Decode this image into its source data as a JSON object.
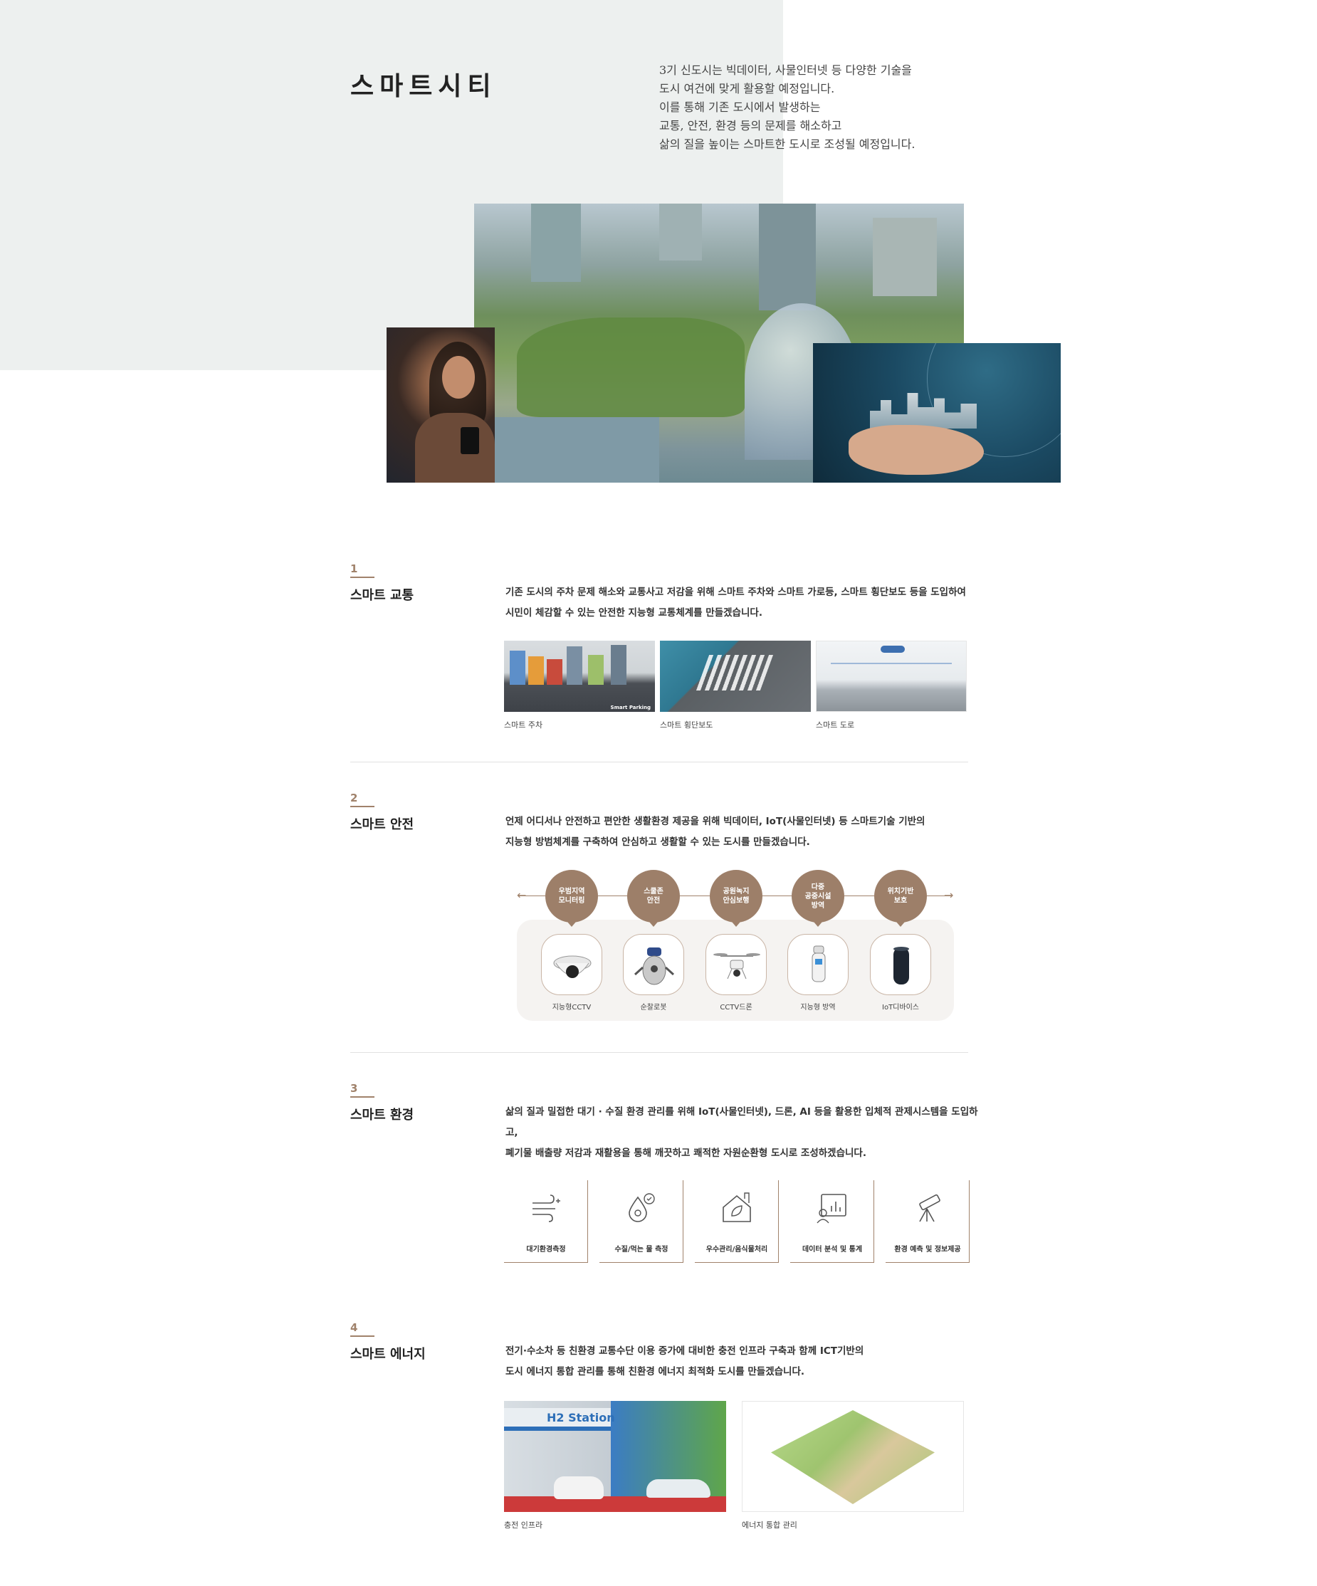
{
  "hero": {
    "title": "스마트시티",
    "desc_lines": [
      "3기 신도시는 빅데이터, 사물인터넷 등 다양한 기술을",
      "도시 여건에 맞게 활용할 예정입니다.",
      "이를 통해 기존 도시에서 발생하는",
      "교통, 안전, 환경 등의 문제를 해소하고",
      "삶의 질을 높이는 스마트한 도시로 조성될 예정입니다."
    ]
  },
  "sections": [
    {
      "num": "1",
      "title": "스마트 교통",
      "desc_lines": [
        "기존 도시의 주차 문제 해소와 교통사고 저감을 위해 스마트 주차와 스마트 가로등, 스마트 횡단보도 등을 도입하여",
        "시민이 체감할 수 있는 안전한 지능형 교통체계를 만들겠습니다."
      ],
      "images": [
        {
          "caption": "스마트 주차",
          "overlay": "Smart Parking"
        },
        {
          "caption": "스마트 횡단보도"
        },
        {
          "caption": "스마트 도로"
        }
      ]
    },
    {
      "num": "2",
      "title": "스마트 안전",
      "desc_lines": [
        "언제 어디서나 안전하고 편안한 생활환경 제공을 위해 빅데이터, IoT(사물인터넷) 등 스마트기술 기반의",
        "지능형 방범체계를 구축하여 안심하고 생활할 수 있는 도시를 만들겠습니다."
      ],
      "circles": [
        [
          "우범지역",
          "모니터링"
        ],
        [
          "스쿨존",
          "안전"
        ],
        [
          "공원녹지",
          "안심보행"
        ],
        [
          "다중",
          "공중시설",
          "방역"
        ],
        [
          "위치기반",
          "보호"
        ]
      ],
      "devices": [
        "지능형CCTV",
        "순찰로봇",
        "CCTV드론",
        "지능형 방역",
        "IoT디바이스"
      ]
    },
    {
      "num": "3",
      "title": "스마트 환경",
      "desc_lines": [
        "삶의 질과 밀접한 대기 · 수질 환경 관리를 위해 IoT(사물인터넷), 드론, AI 등을 활용한 입체적 관제시스템을 도입하",
        "고,",
        "폐기물 배출량 저감과 재활용을 통해 깨끗하고 쾌적한 자원순환형 도시로 조성하겠습니다."
      ],
      "cards": [
        {
          "icon": "air-monitor-icon",
          "label": "대기환경측정"
        },
        {
          "icon": "water-quality-icon",
          "label": "수질/먹는 물 측정"
        },
        {
          "icon": "house-leaf-icon",
          "label": "우수관리/음식물처리"
        },
        {
          "icon": "data-chart-icon",
          "label": "데이터 분석 및 통계"
        },
        {
          "icon": "telescope-icon",
          "label": "환경 예측 및 정보제공"
        }
      ]
    },
    {
      "num": "4",
      "title": "스마트 에너지",
      "desc_lines": [
        "전기·수소차 등 친환경 교통수단 이용 증가에 대비한 충전 인프라 구축과 함께 ICT기반의",
        "도시 에너지 통합 관리를 통해 친환경 에너지 최적화 도시를 만들겠습니다."
      ],
      "images": [
        {
          "caption": "충전 인프라",
          "overlay": "H2 Station"
        },
        {
          "caption": "에너지 통합 관리"
        }
      ]
    }
  ],
  "colors": {
    "accent": "#a0826b",
    "circle": "#9d7f69",
    "hero_bg": "#edf0ef"
  }
}
